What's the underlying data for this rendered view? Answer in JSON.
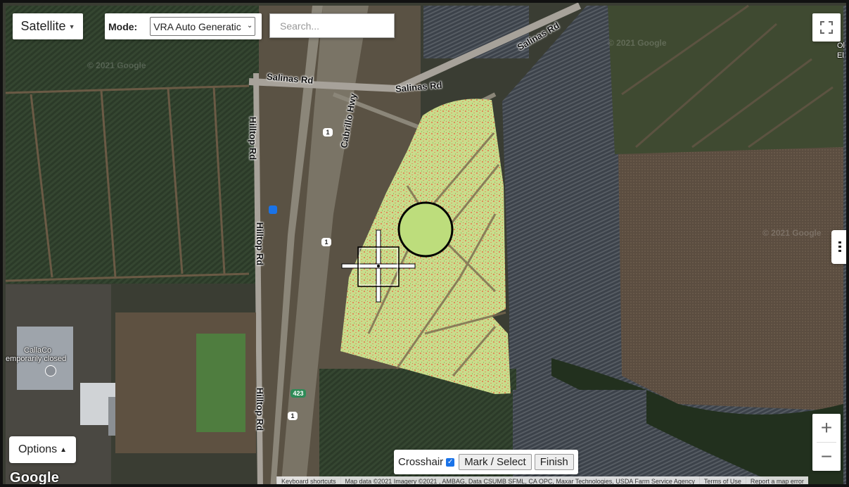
{
  "map": {
    "type_label": "Satellite",
    "mode_label": "Mode:",
    "mode_value": "VRA Auto Generatic",
    "search_placeholder": "Search...",
    "options_label": "Options",
    "crosshair_label": "Crosshair",
    "crosshair_checked": true,
    "mark_button": "Mark / Select",
    "finish_button": "Finish",
    "zoom_in": "+",
    "zoom_out": "−",
    "google_logo": "Google",
    "watermark": "© 2021 Google",
    "roads": {
      "salinas_rd_1": "Salinas Rd",
      "salinas_rd_2": "Salinas Rd",
      "salinas_rd_3": "Salinas Rd",
      "cabrillo_hwy": "Cabrillo Hwy",
      "hilltop_rd_1": "Hilltop Rd",
      "hilltop_rd_2": "Hilltop Rd",
      "hilltop_rd_3": "Hilltop Rd"
    },
    "shields": [
      "1",
      "1",
      "1",
      "423"
    ],
    "poi": {
      "name": "CallaCo",
      "status": "emporarily closed"
    },
    "edge_text": {
      "top": "Ol",
      "bottom": "El"
    },
    "attribution": {
      "shortcuts": "Keyboard shortcuts",
      "data": "Map data ©2021 Imagery ©2021 , AMBAG, Data CSUMB SFML, CA OPC, Maxar Technologies, USDA Farm Service Agency",
      "terms": "Terms of Use",
      "report": "Report a map error"
    },
    "colors": {
      "field_overlay_light": "#c7dc8a",
      "field_overlay_red": "#d9834f",
      "marker_fill": "#bddd7c"
    }
  }
}
